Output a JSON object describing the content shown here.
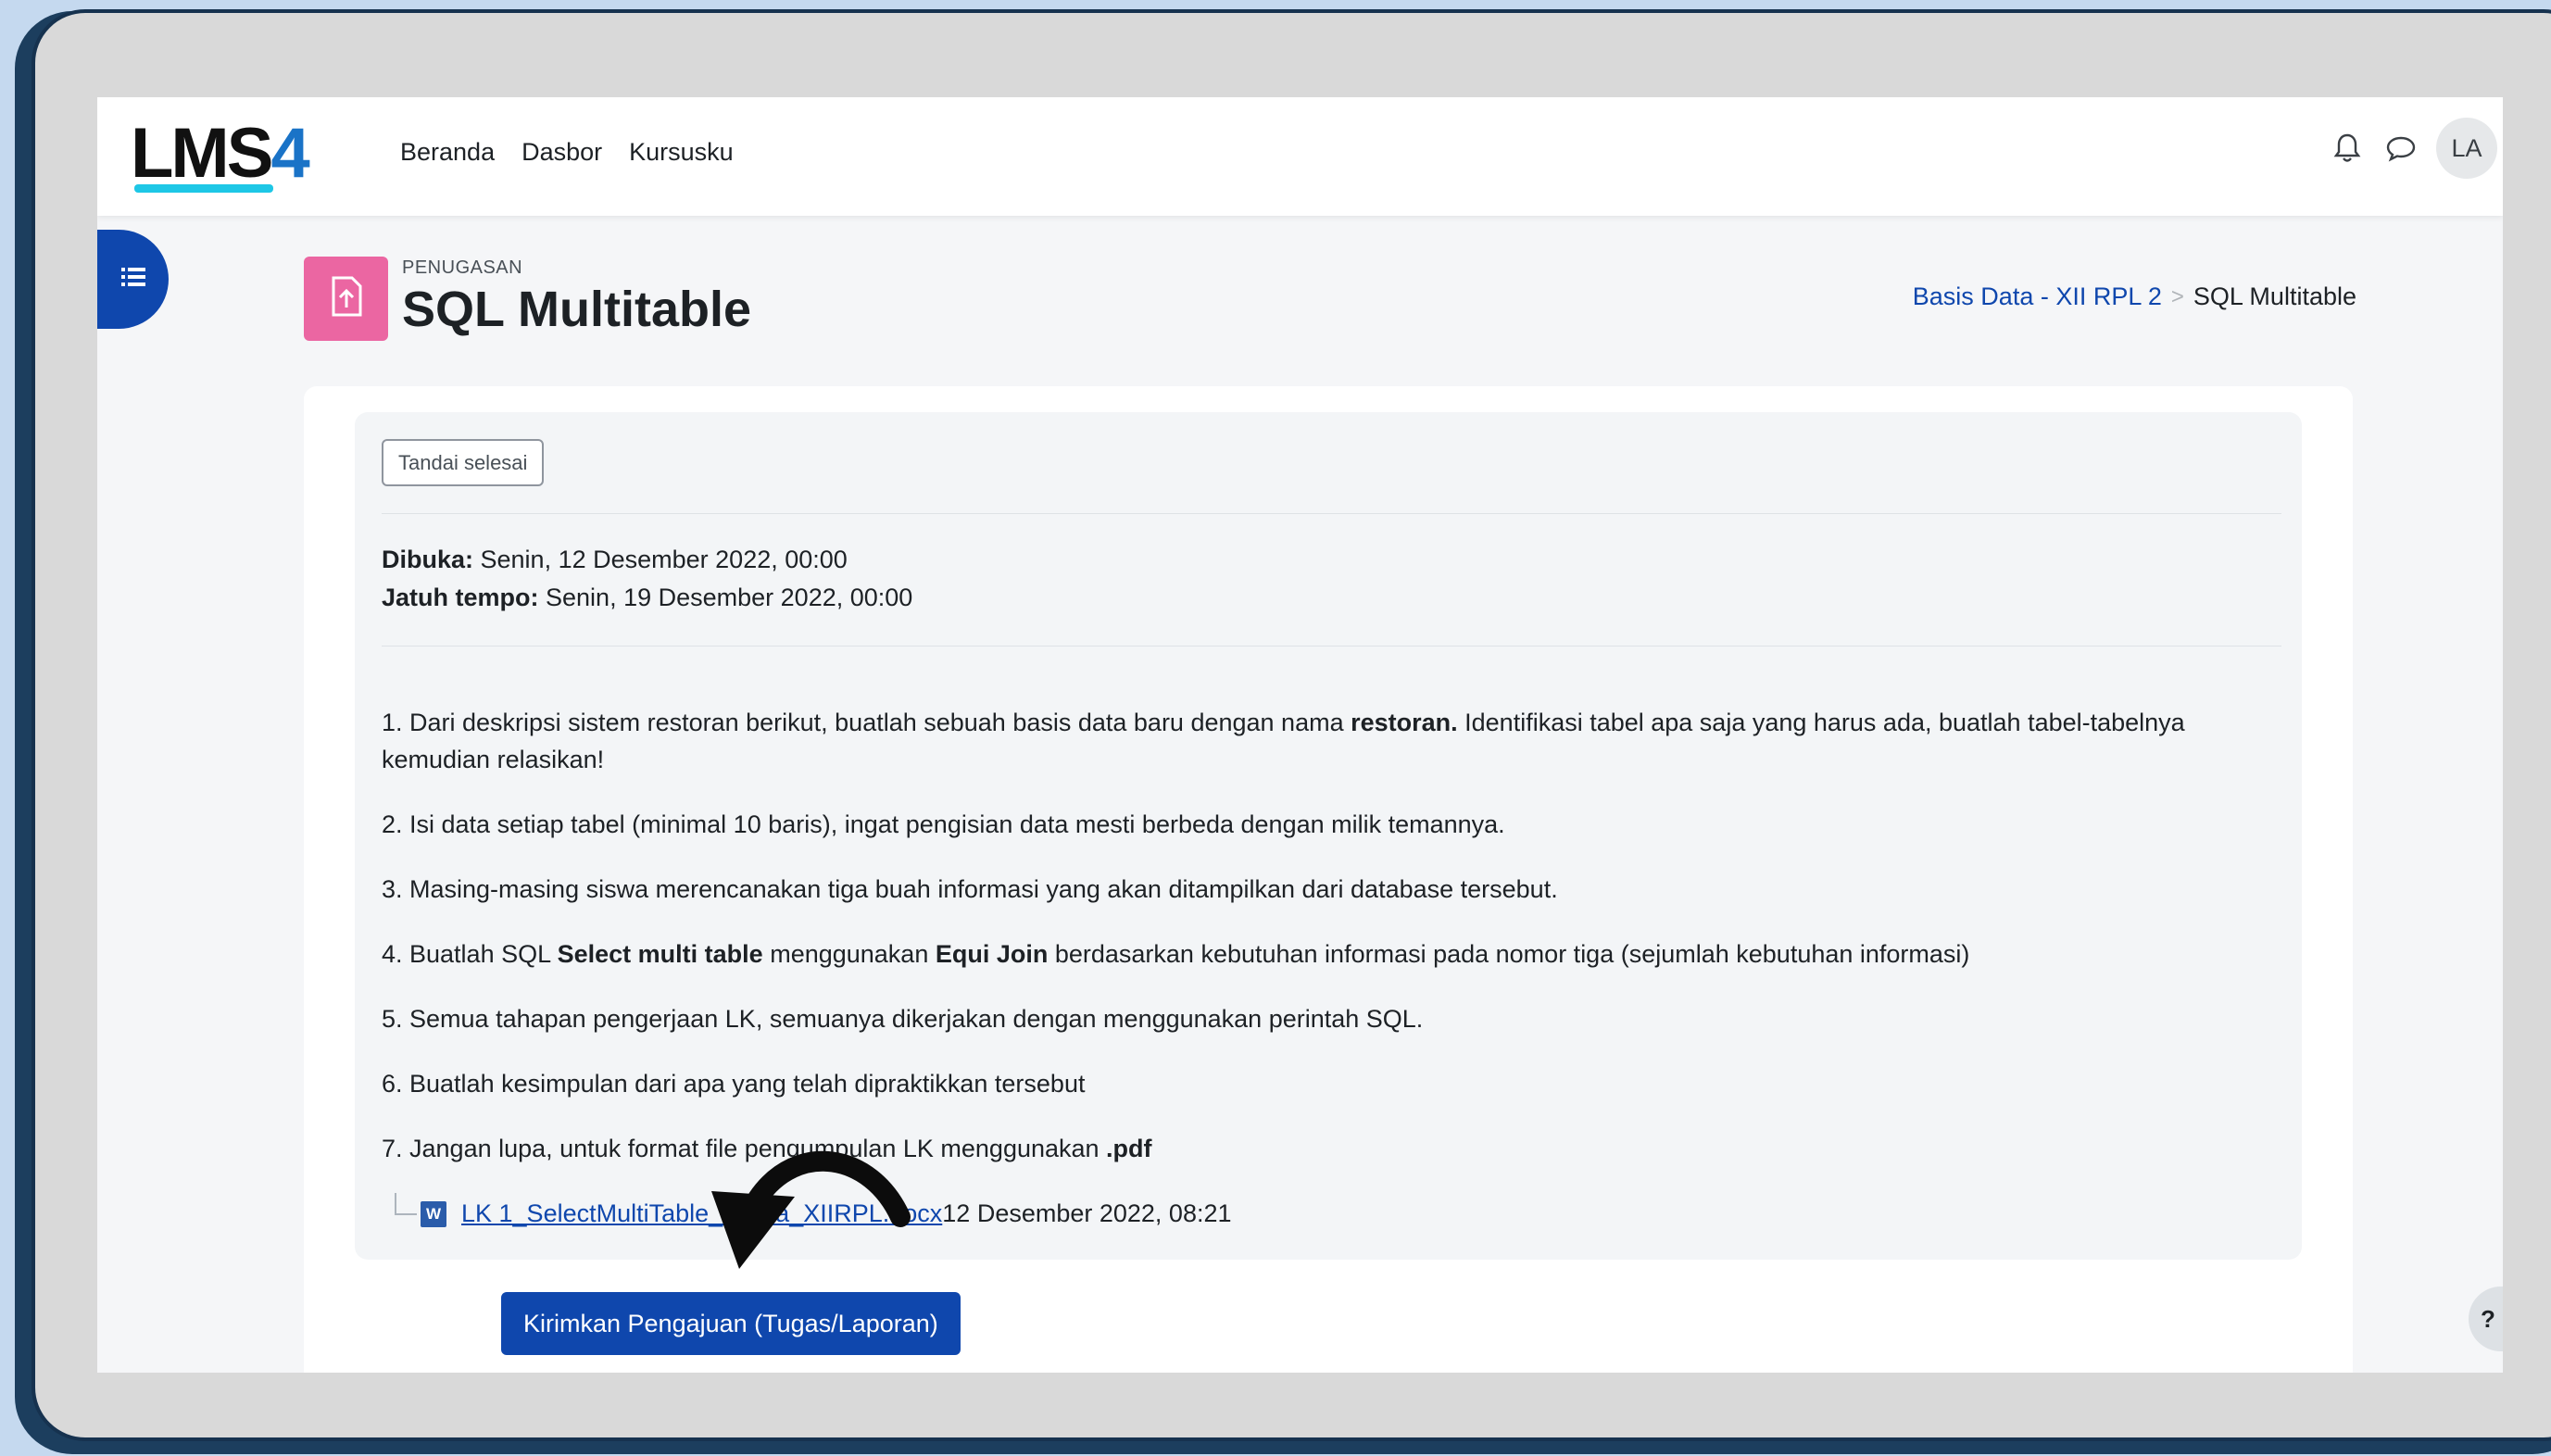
{
  "navbar": {
    "logo_text": "LMS",
    "logo_digit": "4",
    "links": [
      "Beranda",
      "Dasbor",
      "Kursusku"
    ],
    "avatar_initials": "LA"
  },
  "header": {
    "activity_type": "PENUGASAN",
    "title": "SQL Multitable",
    "breadcrumb": {
      "course": "Basis Data - XII RPL 2",
      "separator": ">",
      "current": "SQL Multitable"
    }
  },
  "activity": {
    "mark_done_label": "Tandai selesai",
    "opened_label": "Dibuka:",
    "opened_value": " Senin, 12 Desember 2022, 00:00",
    "due_label": "Jatuh tempo:",
    "due_value": " Senin, 19 Desember 2022, 00:00",
    "instructions": {
      "item1_pre": "1. Dari deskripsi sistem restoran berikut, buatlah sebuah basis data baru dengan nama ",
      "item1_bold": "restoran.",
      "item1_post": " Identifikasi tabel apa saja yang harus ada, buatlah tabel-tabelnya kemudian relasikan!",
      "item2": "2. Isi data setiap tabel (minimal 10  baris), ingat pengisian data mesti berbeda dengan milik temannya.",
      "item3": "3. Masing-masing siswa merencanakan tiga buah informasi yang akan ditampilkan dari database tersebut.",
      "item4_pre": "4. Buatlah SQL ",
      "item4_bold1": "Select multi table",
      "item4_mid": " menggunakan ",
      "item4_bold2": "Equi Join",
      "item4_post": " berdasarkan kebutuhan informasi pada nomor tiga (sejumlah kebutuhan informasi)",
      "item5": "5. Semua tahapan pengerjaan LK, semuanya dikerjakan dengan menggunakan perintah SQL.",
      "item6": "6. Buatlah kesimpulan dari apa yang telah dipraktikkan tersebut",
      "item7_pre": "7. Jangan lupa, untuk format file pengumpulan LK menggunakan ",
      "item7_bold": ".pdf"
    },
    "attachment": {
      "file_icon_letter": "W",
      "file_name": "LK 1_SelectMultiTable_Nama_XIIRPL.docx",
      "uploaded": "12 Desember 2022, 08:21"
    },
    "submit_label": "Kirimkan Pengajuan (Tugas/Laporan)"
  },
  "help_label": "?",
  "icons": {
    "bell": "bell-icon",
    "chat": "chat-icon",
    "drawer": "list-icon",
    "assignment": "file-upload-icon",
    "arrow": "curved-arrow-icon"
  },
  "colors": {
    "brand_blue": "#0f47ad",
    "assignment_pink": "#eb66a2",
    "frame_navy": "#1c3e5e",
    "backdrop": "#c5d9ef"
  }
}
